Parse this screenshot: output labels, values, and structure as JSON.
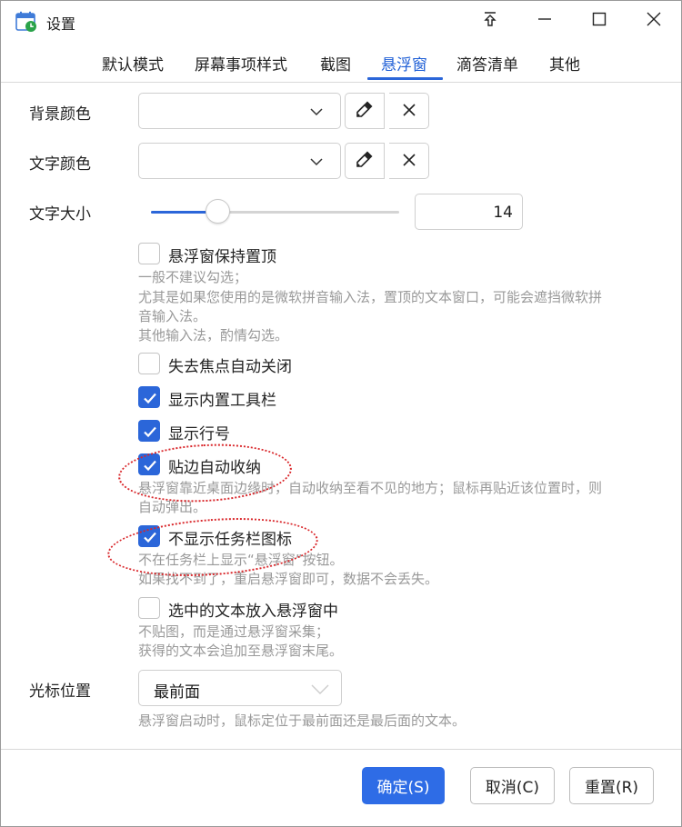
{
  "window": {
    "title": "设置"
  },
  "tabs": [
    {
      "label": "默认模式"
    },
    {
      "label": "屏幕事项样式"
    },
    {
      "label": "截图"
    },
    {
      "label": "悬浮窗",
      "active": true
    },
    {
      "label": "滴答清单"
    },
    {
      "label": "其他"
    }
  ],
  "settings": {
    "bg_color_label": "背景颜色",
    "text_color_label": "文字颜色",
    "font_size_label": "文字大小",
    "font_size_value": "14",
    "font_size_slider_fraction": 0.27,
    "cursor_label": "光标位置",
    "cursor_value": "最前面",
    "cursor_hint": "悬浮窗启动时，鼠标定位于最前面还是最后面的文本。"
  },
  "options": [
    {
      "label": "悬浮窗保持置顶",
      "checked": false,
      "hint": [
        "一般不建议勾选；",
        "尤其是如果您使用的是微软拼音输入法，置顶的文本窗口，可能会遮挡微软拼",
        "音输入法。",
        "其他输入法，酌情勾选。"
      ]
    },
    {
      "label": "失去焦点自动关闭",
      "checked": false,
      "hint": []
    },
    {
      "label": "显示内置工具栏",
      "checked": true,
      "hint": []
    },
    {
      "label": "显示行号",
      "checked": true,
      "hint": []
    },
    {
      "label": "贴边自动收纳",
      "checked": true,
      "hint": [
        "悬浮窗靠近桌面边缘时，自动收纳至看不见的地方；鼠标再贴近该位置时，则",
        "自动弹出。"
      ]
    },
    {
      "label": "不显示任务栏图标",
      "checked": true,
      "hint": [
        "不在任务栏上显示“悬浮窗”按钮。",
        "如果找不到了，重启悬浮窗即可，数据不会丢失。"
      ]
    },
    {
      "label": "选中的文本放入悬浮窗中",
      "checked": false,
      "hint": [
        "不贴图，而是通过悬浮窗采集；",
        "获得的文本会追加至悬浮窗末尾。"
      ]
    }
  ],
  "footer": {
    "ok": "确定(S)",
    "cancel": "取消(C)",
    "reset": "重置(R)"
  },
  "colors": {
    "accent": "#2b66d9",
    "primary_button": "#2e6ce6",
    "annotation": "#d9262a",
    "hint_text": "#999999"
  },
  "icons": [
    "calendar-clock-icon",
    "pin-icon",
    "minimize-icon",
    "maximize-icon",
    "close-icon",
    "chevron-down-icon",
    "eyedropper-icon",
    "clear-icon",
    "check-icon"
  ]
}
